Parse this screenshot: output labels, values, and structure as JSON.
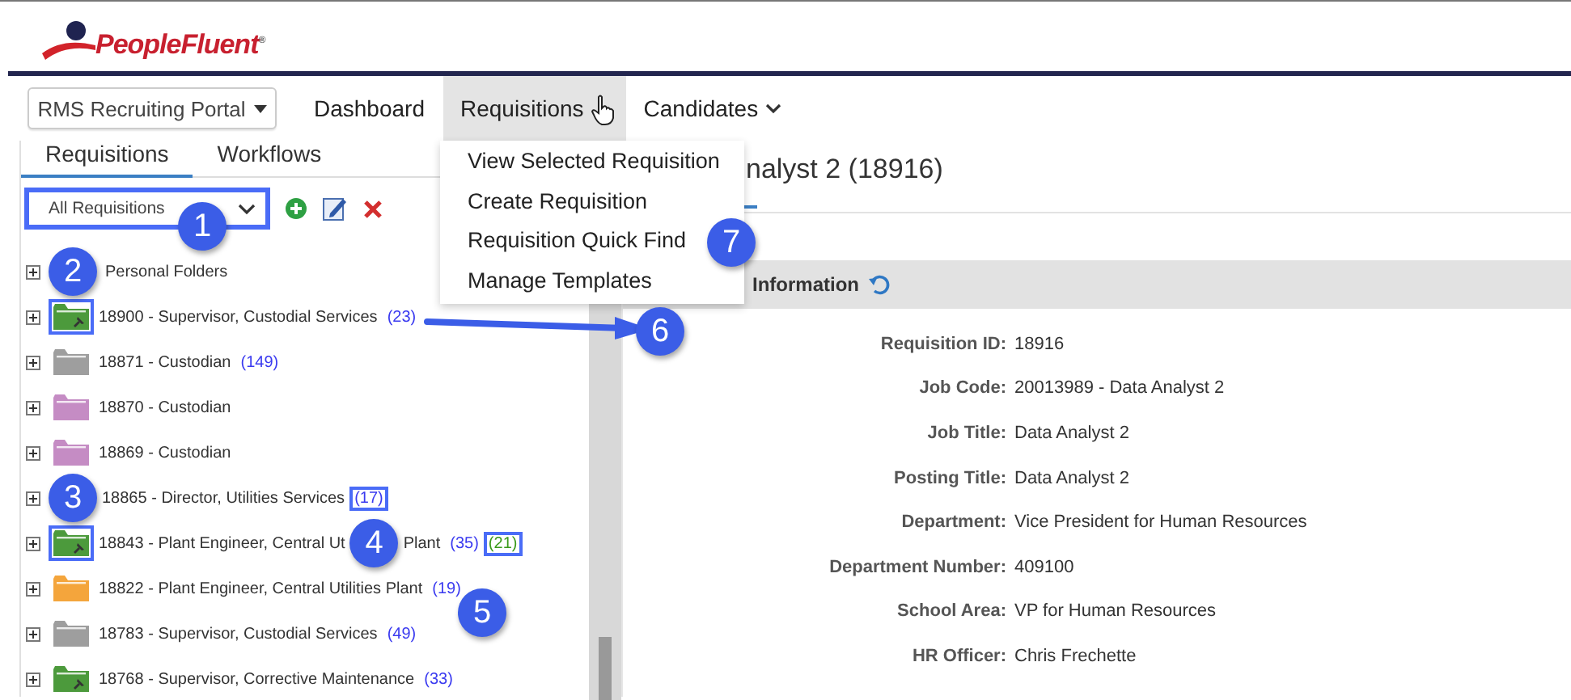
{
  "header": {
    "logo": "PeopleFluent$^{®}$"
  },
  "nav": {
    "portal": "RMS Recruiting Portal",
    "items": [
      {
        "label": "Dashboard",
        "selected": false,
        "has_caret": false
      },
      {
        "label": "Requisitions",
        "selected": true,
        "has_caret": false
      },
      {
        "label": "Candidates",
        "selected": false,
        "has_caret": true
      }
    ]
  },
  "menu": {
    "items": [
      "View Selected Requisition",
      "Create Requisition",
      "Requisition Quick Find",
      "Manage Templates"
    ]
  },
  "left_tabs": [
    {
      "label": "Requisitions",
      "selected": true
    },
    {
      "label": "Workflows",
      "selected": false
    }
  ],
  "filter": {
    "value": "All Requisitions",
    "highlighted": true
  },
  "tree": [
    {
      "kind": "group",
      "icon_callout": "2",
      "label": "Personal Folders"
    },
    {
      "kind": "requisition",
      "label": "18900 - Supervisor, Custodial Services",
      "count": "(23)",
      "color": "#4c9a3c",
      "pinned": true,
      "icon_highlighted": true,
      "count_highlighted": false
    },
    {
      "kind": "requisition",
      "label": "18871 - Custodian",
      "count": "(149)",
      "color": "#9e9e9e",
      "pinned": false,
      "icon_highlighted": false,
      "count_highlighted": false
    },
    {
      "kind": "requisition",
      "label": "18870 - Custodian",
      "color": "#c58cc4",
      "pinned": false,
      "icon_highlighted": false
    },
    {
      "kind": "requisition",
      "label": "18869 - Custodian",
      "color": "#c58cc4",
      "pinned": false,
      "icon_highlighted": false
    },
    {
      "kind": "requisition",
      "icon_callout": "3",
      "label": "18865 - Director, Utilities Services",
      "count": "(17)",
      "count_highlighted": true
    },
    {
      "kind": "requisition",
      "label": "18843 - Plant Engineer, Central Ut",
      "callout": "4",
      "label_rest": "Plant",
      "count": "(35)",
      "extra_count": "(21)",
      "color": "#4c9a3c",
      "pinned": true,
      "icon_highlighted": true,
      "count_highlighted": false,
      "extra_count_highlighted": true
    },
    {
      "kind": "requisition",
      "label": "18822 - Plant Engineer, Central Utilities Plant",
      "count": "(19)",
      "color": "#f4a53c",
      "pinned": false,
      "icon_highlighted": false,
      "count_highlighted": false
    },
    {
      "kind": "requisition",
      "label": "18783 - Supervisor, Custodial Services",
      "count": "(49)",
      "color": "#9e9e9e",
      "pinned": false,
      "icon_highlighted": false,
      "count_highlighted": false
    },
    {
      "kind": "requisition",
      "label": "18768 - Supervisor, Corrective Maintenance",
      "count": "(33)",
      "color": "#4c9a3c",
      "pinned": true,
      "icon_highlighted": false,
      "count_highlighted": false
    }
  ],
  "page_title": "nalyst 2 (18916)",
  "section": {
    "title": "Information"
  },
  "details": [
    {
      "label": "Requisition ID:",
      "value": "18916"
    },
    {
      "label": "Job Code:",
      "value": "20013989 - Data Analyst 2"
    },
    {
      "label": "Job Title:",
      "value": "Data Analyst 2"
    },
    {
      "label": "Posting Title:",
      "value": "Data Analyst 2"
    },
    {
      "label": "Department:",
      "value": "Vice President for Human Resources"
    },
    {
      "label": "Department Number:",
      "value": "409100"
    },
    {
      "label": "School Area:",
      "value": "VP for Human Resources"
    },
    {
      "label": "HR Officer:",
      "value": "Chris Frechette"
    }
  ],
  "callouts": [
    "1",
    "5",
    "6",
    "7"
  ]
}
